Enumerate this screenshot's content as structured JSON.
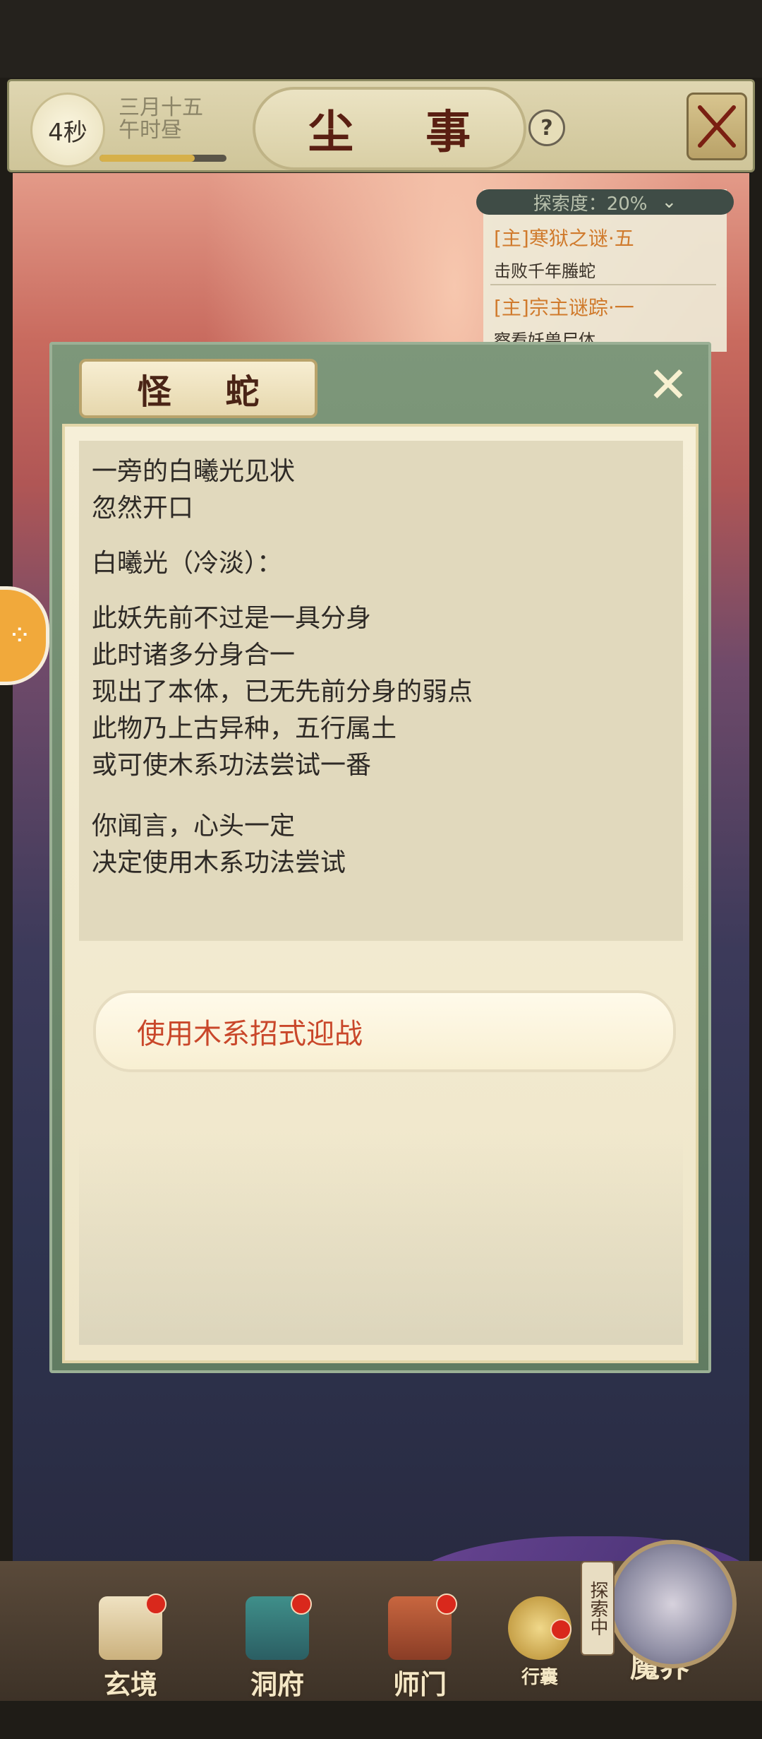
{
  "header": {
    "timer": "4秒",
    "date_line1": "三月十五",
    "date_line2": "午时昼",
    "time_progress": 0.75,
    "title": "尘 事",
    "help": "?"
  },
  "quests": {
    "explore_label": "探索度：20%",
    "items": [
      {
        "title": "[主]寒狱之谜·五",
        "sub": "击败千年螣蛇"
      },
      {
        "title": "[主]宗主谜踪·一",
        "sub": "察看妖兽尸体"
      }
    ]
  },
  "dialog": {
    "title": "怪 蛇",
    "close": "✕",
    "paragraphs": [
      [
        "一旁的白曦光见状",
        "忽然开口"
      ],
      [
        "白曦光（冷淡）："
      ],
      [
        "此妖先前不过是一具分身",
        "此时诸多分身合一",
        "现出了本体，已无先前分身的弱点",
        "此物乃上古异种，五行属土",
        "或可使木系功法尝试一番"
      ],
      [
        "你闻言，心头一定",
        "决定使用木系功法尝试"
      ]
    ],
    "choice": "使用木系招式迎战"
  },
  "nav": {
    "items": [
      "玄境",
      "洞府",
      "师门",
      "行囊",
      "魔界"
    ],
    "explore_status": "探索中"
  },
  "colors": {
    "accent": "#c9472a",
    "quest_title": "#d07a2c",
    "panel_green": "#7d977a"
  }
}
